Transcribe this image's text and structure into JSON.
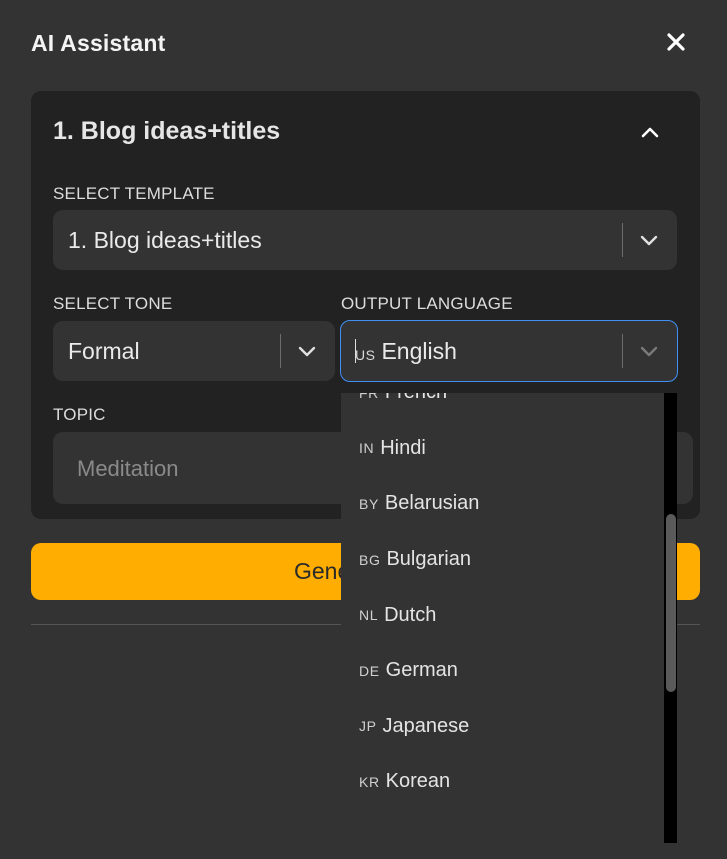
{
  "header": {
    "title": "AI Assistant"
  },
  "panel": {
    "title": "1. Blog ideas+titles",
    "template": {
      "label": "SELECT TEMPLATE",
      "value": "1. Blog ideas+titles"
    },
    "tone": {
      "label": "SELECT TONE",
      "value": "Formal"
    },
    "language": {
      "label": "OUTPUT LANGUAGE",
      "flag": "US",
      "value": "English"
    },
    "topic": {
      "label": "TOPIC",
      "placeholder": "Meditation"
    }
  },
  "generate_button": {
    "label_visible": "Gene"
  },
  "language_options": [
    {
      "code": "FR",
      "name": "French"
    },
    {
      "code": "IN",
      "name": "Hindi"
    },
    {
      "code": "BY",
      "name": "Belarusian"
    },
    {
      "code": "BG",
      "name": "Bulgarian"
    },
    {
      "code": "NL",
      "name": "Dutch"
    },
    {
      "code": "DE",
      "name": "German"
    },
    {
      "code": "JP",
      "name": "Japanese"
    },
    {
      "code": "KR",
      "name": "Korean"
    }
  ],
  "colors": {
    "background": "#333333",
    "panel": "#222222",
    "accent": "#ffad00",
    "focus": "#3f8ff5"
  }
}
